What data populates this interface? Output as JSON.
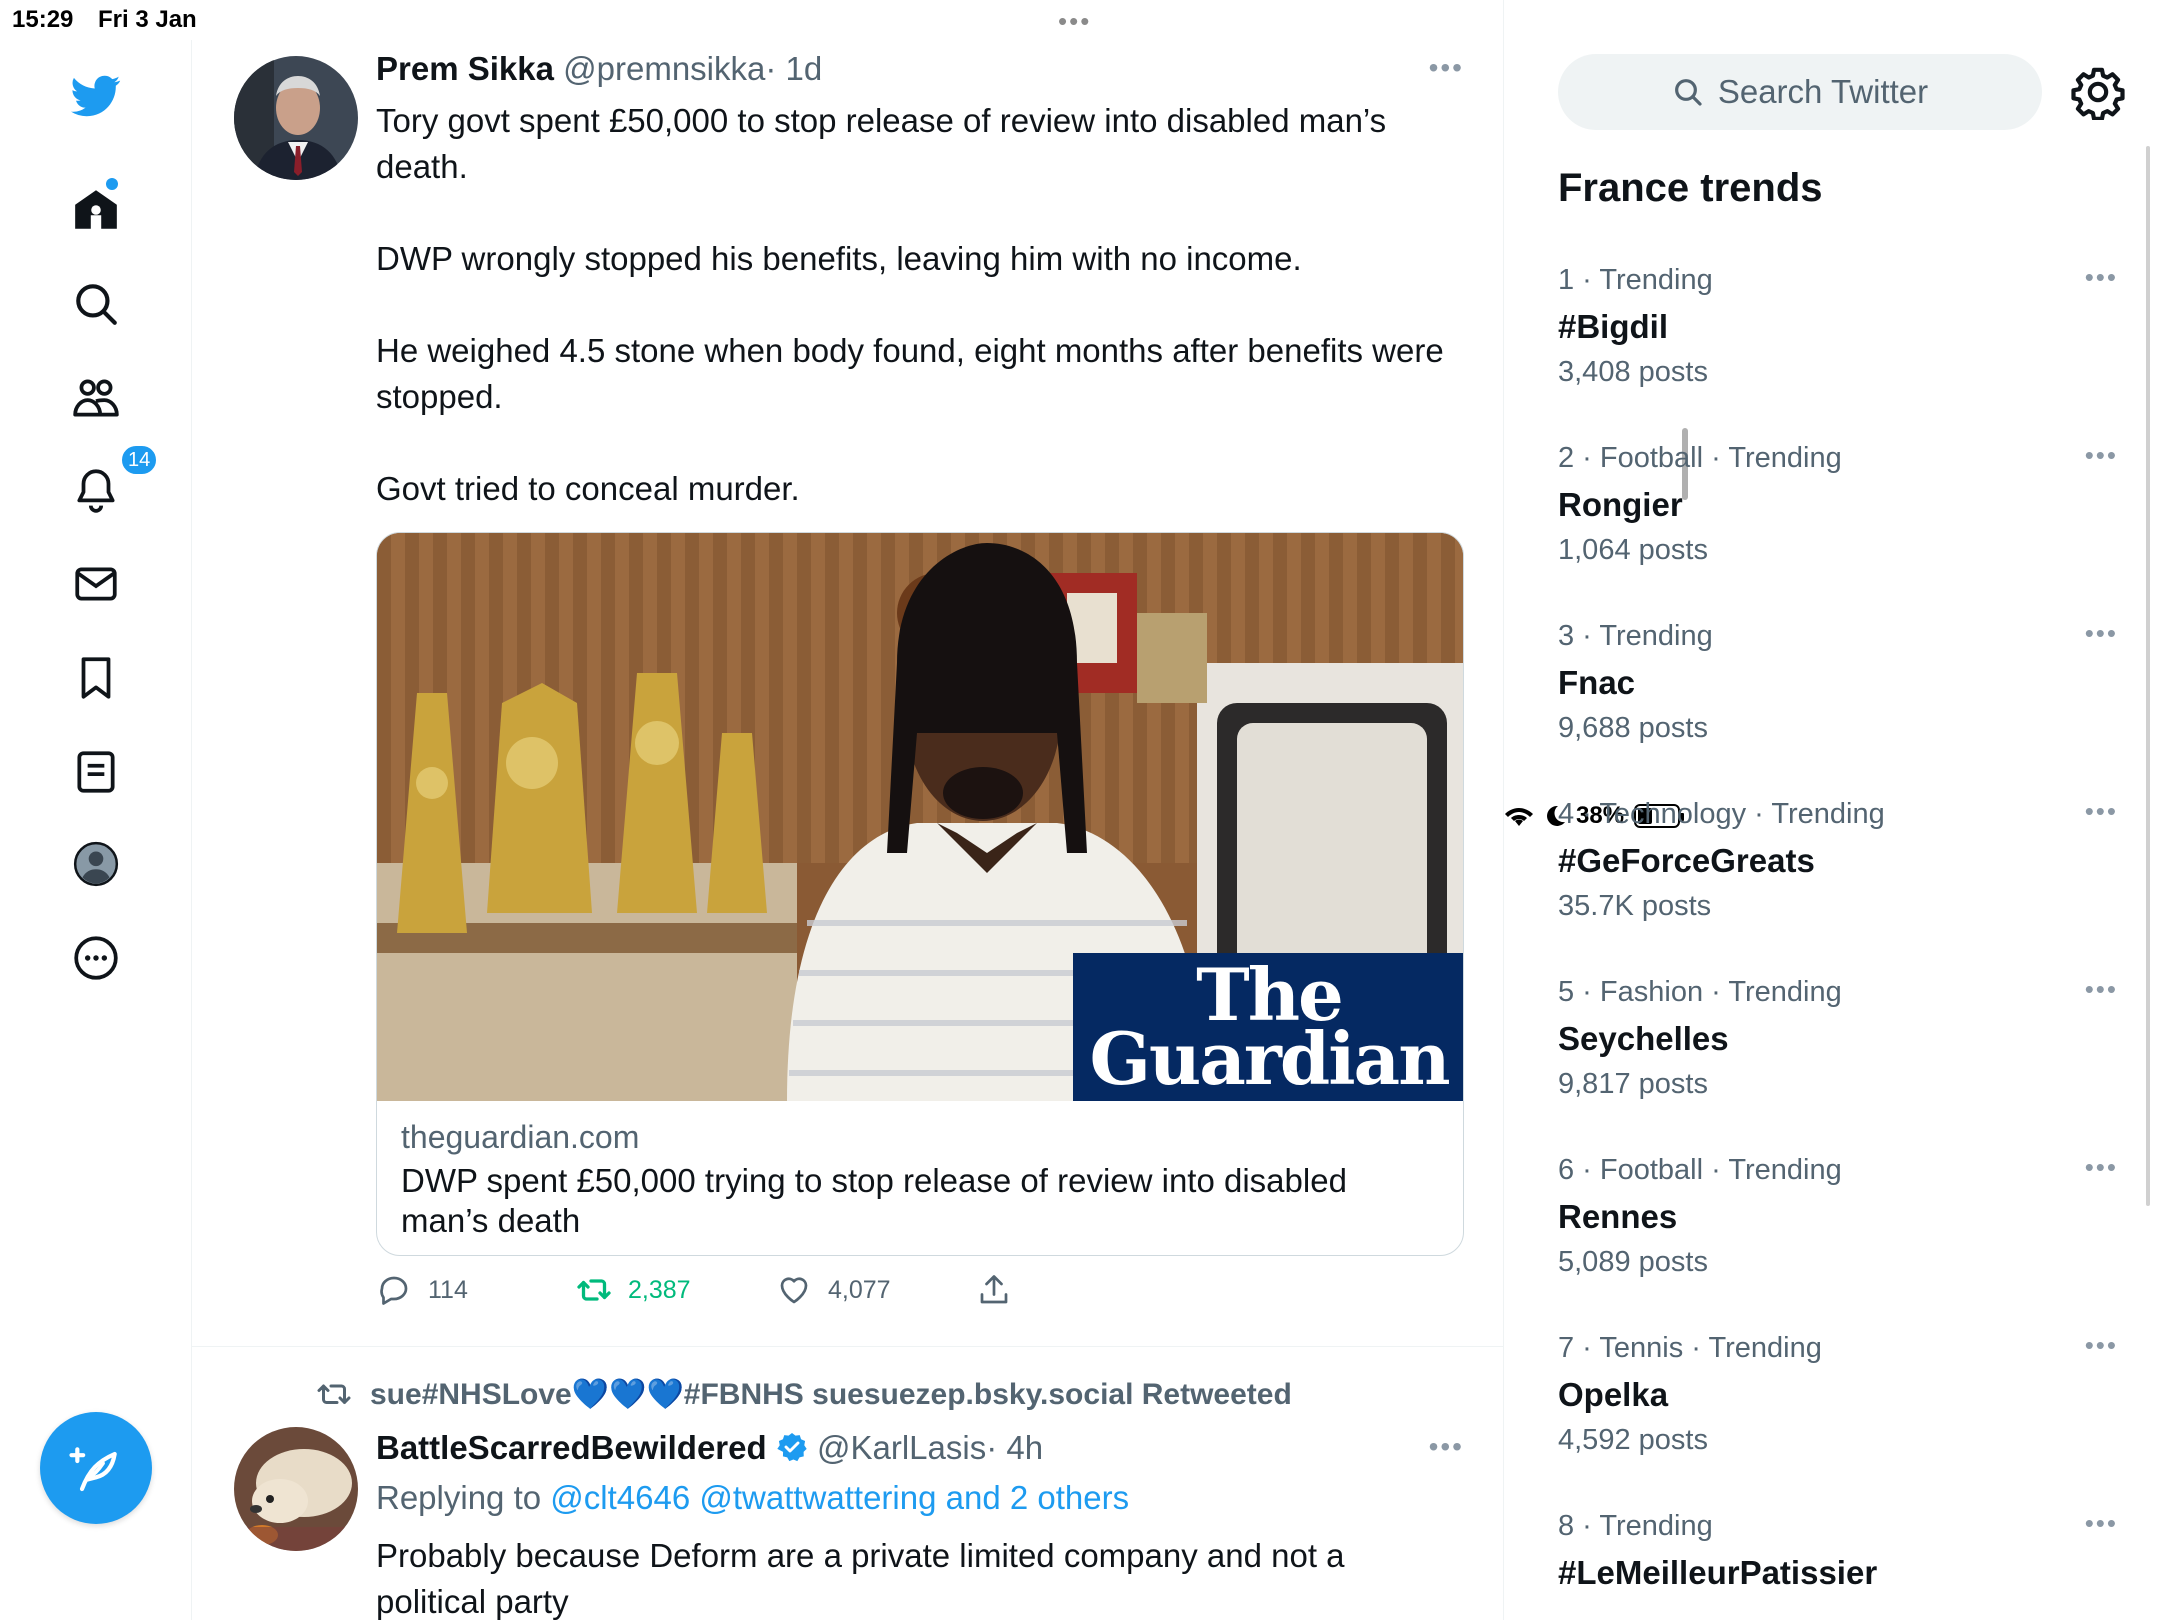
{
  "status_bar": {
    "time": "15:29",
    "date": "Fri 3 Jan",
    "multitask_dots": "•••",
    "battery": "38%"
  },
  "nav": {
    "notifications_badge": "14"
  },
  "tweets": [
    {
      "name": "Prem Sikka",
      "handle": "@premnsikka",
      "time": "· 1d",
      "paragraphs": [
        "Tory govt spent £50,000 to stop release of review into disabled man’s death.",
        "DWP wrongly stopped his benefits, leaving him with no income.",
        "He weighed 4.5 stone when body found, eight months after benefits were stopped.",
        "Govt tried to conceal murder."
      ],
      "card": {
        "logo_line1": "The",
        "logo_line2": "Guardian",
        "domain": "theguardian.com",
        "title": "DWP spent £50,000 trying to stop release of review into disabled man’s death"
      },
      "replies": "114",
      "retweets": "2,387",
      "likes": "4,077"
    },
    {
      "retweeted_by": "sue#NHSLove💙💙💙#FBNHS suesuezep.bsky.social Retweeted",
      "name": "BattleScarredBewildered",
      "handle": "@KarlLasis",
      "time": "· 4h",
      "replying_prefix": "Replying to",
      "replying_links": "@clt4646 @twattwattering and 2 others",
      "text": "Probably because Deform are a private limited company and not a political party"
    }
  ],
  "sidebar": {
    "search_placeholder": "Search Twitter",
    "trends_title": "France trends",
    "trends": [
      {
        "meta": "1 · Trending",
        "name": "#Bigdil",
        "count": "3,408 posts"
      },
      {
        "meta": "2 · Football · Trending",
        "name": "Rongier",
        "count": "1,064 posts"
      },
      {
        "meta": "3 · Trending",
        "name": "Fnac",
        "count": "9,688 posts"
      },
      {
        "meta": "4 · Technology · Trending",
        "name": "#GeForceGreats",
        "count": "35.7K posts"
      },
      {
        "meta": "5 · Fashion · Trending",
        "name": "Seychelles",
        "count": "9,817 posts"
      },
      {
        "meta": "6 · Football · Trending",
        "name": "Rennes",
        "count": "5,089 posts"
      },
      {
        "meta": "7 · Tennis · Trending",
        "name": "Opelka",
        "count": "4,592 posts"
      },
      {
        "meta": "8 · Trending",
        "name": "#LeMeilleurPatissier",
        "count": ""
      }
    ]
  },
  "colors": {
    "accent": "#1d9bf0",
    "retweet_green": "#00ba7c",
    "guardian_blue": "#052962",
    "secondary_text": "#536471"
  }
}
